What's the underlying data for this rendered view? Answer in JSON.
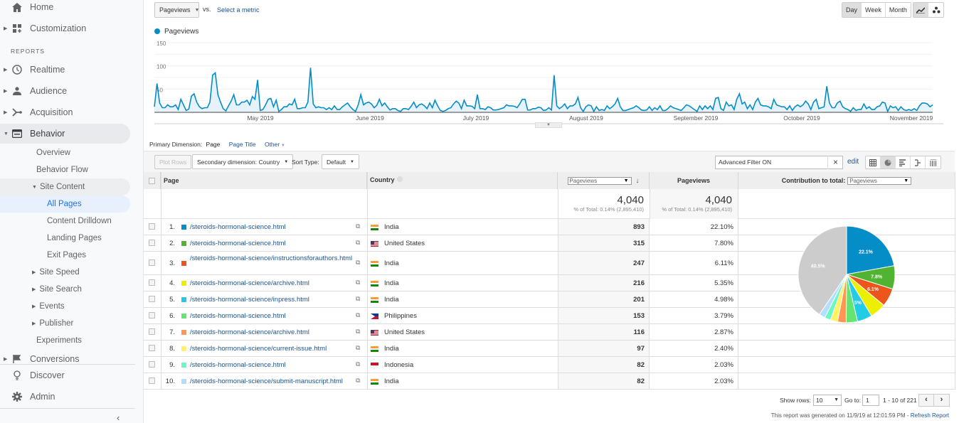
{
  "sidebar": {
    "home": "Home",
    "customization": "Customization",
    "reports_label": "REPORTS",
    "realtime": "Realtime",
    "audience": "Audience",
    "acquisition": "Acquisition",
    "behavior": "Behavior",
    "behavior_items": [
      "Overview",
      "Behavior Flow"
    ],
    "site_content": "Site Content",
    "site_content_items": [
      "All Pages",
      "Content Drilldown",
      "Landing Pages",
      "Exit Pages"
    ],
    "behavior_groups": [
      "Site Speed",
      "Site Search",
      "Events",
      "Publisher"
    ],
    "experiments": "Experiments",
    "conversions": "Conversions",
    "discover": "Discover",
    "admin": "Admin",
    "collapse_icon": "chevron-left-icon"
  },
  "toolbar": {
    "metric": "Pageviews",
    "vs": "vs.",
    "select_metric": "Select a metric",
    "granularity": [
      "Day",
      "Week",
      "Month"
    ],
    "granularity_selected": "Day"
  },
  "chart_data": {
    "type": "line",
    "title": "",
    "legend": [
      "Pageviews"
    ],
    "series_color": "#058dc7",
    "ylim": [
      0,
      150
    ],
    "yticks": [
      "150",
      "100",
      "50"
    ],
    "xticks": [
      "May 2019",
      "June 2019",
      "July 2019",
      "August 2019",
      "September 2019",
      "October 2019",
      "November 2019"
    ],
    "series": [
      {
        "name": "Pageviews",
        "values": [
          12,
          62,
          20,
          10,
          10,
          16,
          12,
          12,
          16,
          6,
          28,
          16,
          4,
          7,
          35,
          40,
          22,
          12,
          8,
          10,
          10,
          22,
          80,
          85,
          38,
          22,
          8,
          3,
          14,
          24,
          38,
          16,
          16,
          22,
          22,
          26,
          16,
          34,
          28,
          70,
          4,
          6,
          16,
          28,
          30,
          12,
          26,
          2,
          6,
          12,
          12,
          18,
          16,
          28,
          8,
          8,
          10,
          10,
          22,
          96,
          18,
          10,
          12,
          10,
          10,
          6,
          10,
          6,
          14,
          6,
          6,
          12,
          16,
          20,
          12,
          6,
          2,
          16,
          38,
          16,
          20,
          22,
          18,
          10,
          15,
          28,
          14,
          20,
          12,
          5,
          8,
          8,
          4,
          2,
          8,
          8,
          6,
          13,
          22,
          10,
          16,
          18,
          14,
          8,
          20,
          10,
          26,
          14,
          4,
          2,
          4,
          8,
          10,
          18,
          24,
          20,
          8,
          26,
          14,
          14,
          13,
          8,
          38,
          8,
          8,
          6,
          12,
          10,
          5,
          5,
          6,
          8,
          10,
          16,
          14,
          14,
          13,
          10,
          18,
          28,
          28,
          5,
          5,
          8,
          8,
          11,
          10,
          4,
          5,
          10,
          5,
          80,
          14,
          8,
          12,
          18,
          8,
          14,
          14,
          18,
          32,
          10,
          2,
          12,
          16,
          14,
          2,
          12,
          4,
          6,
          4,
          14,
          8,
          12,
          18,
          30,
          12,
          4,
          4,
          6,
          8,
          10,
          14,
          10,
          5,
          4,
          5,
          12,
          4,
          10,
          6,
          14,
          4,
          4,
          8,
          14,
          10,
          8,
          6,
          4,
          10,
          16,
          14,
          10,
          6,
          2,
          14,
          6,
          14,
          8,
          14,
          6,
          30,
          32,
          8,
          4,
          22,
          14,
          16,
          6,
          28,
          40,
          18,
          22,
          8,
          16,
          6,
          22,
          30,
          16,
          14,
          14,
          12,
          8,
          28,
          16,
          14,
          12,
          12,
          6,
          14,
          4,
          12,
          16,
          12,
          16,
          24,
          18,
          6,
          22,
          28,
          8,
          10,
          12,
          56,
          20,
          10,
          10,
          20,
          24,
          12,
          8,
          6,
          2,
          10,
          4,
          6,
          6,
          18,
          8,
          12,
          6,
          6,
          12,
          14,
          22,
          20,
          2,
          14,
          10,
          12,
          4,
          12,
          6,
          4,
          6,
          4,
          8,
          4,
          14,
          20,
          20,
          18,
          12,
          16
        ]
      }
    ]
  },
  "dimension_bar": {
    "label": "Primary Dimension:",
    "options": [
      "Page",
      "Page Title",
      "Other"
    ],
    "selected": "Page"
  },
  "table_controls": {
    "plot_rows": "Plot Rows",
    "secondary_dimension": "Secondary dimension: Country",
    "sort_type_label": "Sort Type:",
    "sort_type": "Default",
    "filter_value": "Advanced Filter ON",
    "edit": "edit"
  },
  "table": {
    "headers": {
      "page": "Page",
      "country": "Country",
      "metric_select": "Pageviews",
      "pageviews": "Pageviews",
      "contribution": "Contribution to total:",
      "contribution_select": "Pageviews"
    },
    "totals": {
      "value1": "4,040",
      "sub1": "% of Total: 0.14% (2,895,410)",
      "value2": "4,040",
      "sub2": "% of Total: 0.14% (2,895,410)"
    },
    "rows": [
      {
        "n": "1.",
        "color": "#058dc7",
        "page": "/steroids-hormonal-science.html",
        "country": "India",
        "flag": "in",
        "pv": "893",
        "pct": "22.10%"
      },
      {
        "n": "2.",
        "color": "#50b432",
        "page": "/steroids-hormonal-science.html",
        "country": "United States",
        "flag": "us",
        "pv": "315",
        "pct": "7.80%"
      },
      {
        "n": "3.",
        "color": "#ed561b",
        "page": "/steroids-hormonal-science/instructionsforauthors.html",
        "country": "India",
        "flag": "in",
        "pv": "247",
        "pct": "6.11%"
      },
      {
        "n": "4.",
        "color": "#edef00",
        "page": "/steroids-hormonal-science/archive.html",
        "country": "India",
        "flag": "in",
        "pv": "216",
        "pct": "5.35%"
      },
      {
        "n": "5.",
        "color": "#24cbe5",
        "page": "/steroids-hormonal-science/inpress.html",
        "country": "India",
        "flag": "in",
        "pv": "201",
        "pct": "4.98%"
      },
      {
        "n": "6.",
        "color": "#64e572",
        "page": "/steroids-hormonal-science.html",
        "country": "Philippines",
        "flag": "ph",
        "pv": "153",
        "pct": "3.79%"
      },
      {
        "n": "7.",
        "color": "#ff9655",
        "page": "/steroids-hormonal-science/archive.html",
        "country": "United States",
        "flag": "us",
        "pv": "116",
        "pct": "2.87%"
      },
      {
        "n": "8.",
        "color": "#fff263",
        "page": "/steroids-hormonal-science/current-issue.html",
        "country": "India",
        "flag": "in",
        "pv": "97",
        "pct": "2.40%"
      },
      {
        "n": "9.",
        "color": "#6af9c4",
        "page": "/steroids-hormonal-science.html",
        "country": "Indonesia",
        "flag": "id",
        "pv": "82",
        "pct": "2.03%"
      },
      {
        "n": "10.",
        "color": "#b2deff",
        "page": "/steroids-hormonal-science/submit-manuscript.html",
        "country": "India",
        "flag": "in",
        "pv": "82",
        "pct": "2.03%"
      }
    ],
    "pie": {
      "slices": [
        22.1,
        7.8,
        6.11,
        5.35,
        4.98,
        3.79,
        2.87,
        2.4,
        2.03,
        2.03,
        40.5
      ],
      "colors": [
        "#058dc7",
        "#50b432",
        "#ed561b",
        "#edef00",
        "#24cbe5",
        "#64e572",
        "#ff9655",
        "#fff263",
        "#6af9c4",
        "#b2deff",
        "#cccccc"
      ],
      "labels": [
        "22.1%",
        "7.8%",
        "6.1%",
        "",
        "5%",
        "",
        "",
        "",
        "",
        "",
        "40.5%"
      ]
    }
  },
  "footer": {
    "show_rows_label": "Show rows:",
    "show_rows": "10",
    "goto_label": "Go to:",
    "goto": "1",
    "range": "1 - 10 of 221",
    "generated": "This report was generated on 11/9/19 at 12:01:59 PM - ",
    "refresh": "Refresh Report"
  }
}
